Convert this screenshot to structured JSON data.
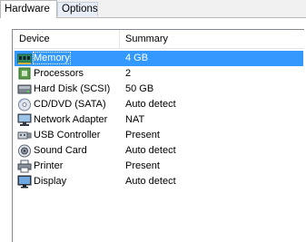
{
  "tabs": [
    {
      "label": "Hardware",
      "active": true
    },
    {
      "label": "Options",
      "active": false
    }
  ],
  "columns": {
    "device": "Device",
    "summary": "Summary"
  },
  "rows": [
    {
      "device": "Memory",
      "summary": "4 GB",
      "icon": "memory-icon",
      "selected": true
    },
    {
      "device": "Processors",
      "summary": "2",
      "icon": "processor-icon",
      "selected": false
    },
    {
      "device": "Hard Disk (SCSI)",
      "summary": "50 GB",
      "icon": "hard-disk-icon",
      "selected": false
    },
    {
      "device": "CD/DVD (SATA)",
      "summary": "Auto detect",
      "icon": "cd-dvd-icon",
      "selected": false
    },
    {
      "device": "Network Adapter",
      "summary": "NAT",
      "icon": "network-adapter-icon",
      "selected": false
    },
    {
      "device": "USB Controller",
      "summary": "Present",
      "icon": "usb-icon",
      "selected": false
    },
    {
      "device": "Sound Card",
      "summary": "Auto detect",
      "icon": "sound-card-icon",
      "selected": false
    },
    {
      "device": "Printer",
      "summary": "Present",
      "icon": "printer-icon",
      "selected": false
    },
    {
      "device": "Display",
      "summary": "Auto detect",
      "icon": "display-icon",
      "selected": false
    }
  ],
  "colors": {
    "selection": "#3399ff",
    "border": "#828790"
  }
}
